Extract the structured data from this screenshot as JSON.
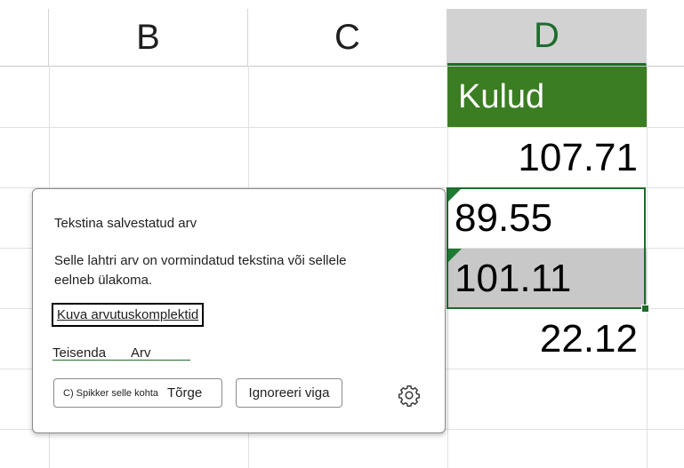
{
  "columns": [
    {
      "label": "B",
      "active": false
    },
    {
      "label": "C",
      "active": false
    },
    {
      "label": "D",
      "active": true
    }
  ],
  "cells": {
    "d_header": "Kulud",
    "d_row1": "107.71",
    "d_row2": "89.55",
    "d_row3": "101.11",
    "d_row4": "22.12"
  },
  "colors": {
    "header_fill": "#3a7d22",
    "selection": "#1e6b2e",
    "error_triangle": "#1f7a33"
  },
  "popup": {
    "title": "Tekstina salvestatud arv",
    "description": "Selle lahtri arv on vormindatud tekstina või sellele eelneb ülakoma.",
    "link_label": "Kuva arvutuskomplektid",
    "convert_label": "Teisenda",
    "convert_value": "Arv",
    "help_button_small": "C) Spikker selle kohta",
    "help_button_label": "Tõrge",
    "ignore_button": "Ignoreeri viga",
    "settings_icon": "gear-icon"
  }
}
